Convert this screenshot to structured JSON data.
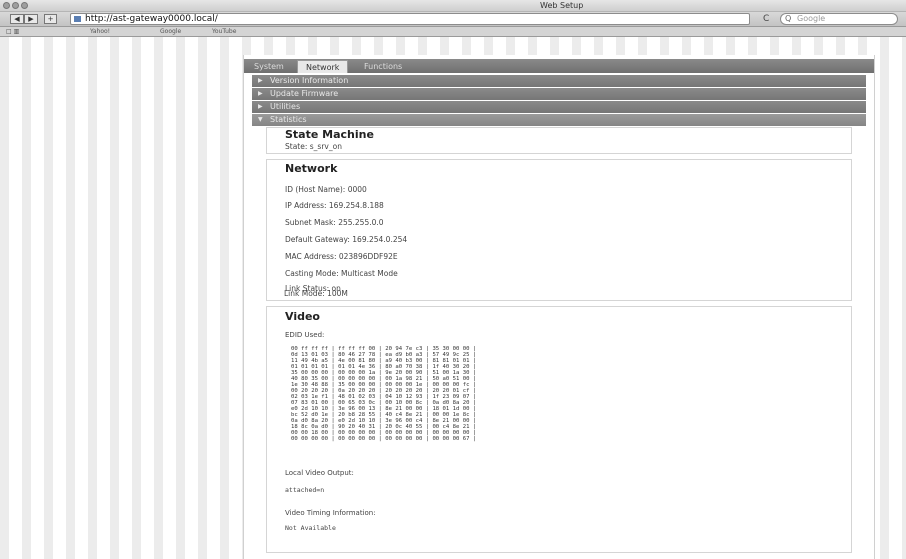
{
  "window": {
    "title": "Web Setup"
  },
  "toolbar": {
    "url": "http://ast-gateway0000.local/",
    "search_placeholder": "Google",
    "back_glyph": "◀",
    "forward_glyph": "▶",
    "add_glyph": "+",
    "reload_glyph": "C"
  },
  "bookmarks": [
    "Yahoo!",
    "Google",
    "YouTube"
  ],
  "tabs": [
    {
      "label": "System"
    },
    {
      "label": "Network"
    },
    {
      "label": "Functions"
    }
  ],
  "sections": [
    {
      "label": "Version Information",
      "expanded": false
    },
    {
      "label": "Update Firmware",
      "expanded": false
    },
    {
      "label": "Utilities",
      "expanded": false
    },
    {
      "label": "Statistics",
      "expanded": true
    }
  ],
  "state_machine": {
    "title": "State Machine",
    "state": "State: s_srv_on"
  },
  "network": {
    "title": "Network",
    "fields": [
      "ID (Host Name): 0000",
      "IP Address: 169.254.8.188",
      "Subnet Mask: 255.255.0.0",
      "Default Gateway: 169.254.0.254",
      "MAC Address: 023896DDF92E",
      "Casting Mode: Multicast Mode",
      "Link Status: on",
      "Link Mode: 100M"
    ]
  },
  "video": {
    "title": "Video",
    "edid_label": "EDID Used:",
    "edid_rows": [
      "00 ff ff ff | ff ff ff 00 | 20 94 7e c3 | 35 30 00 00 |",
      "0d 13 01 03 | 80 46 27 78 | ea d9 b0 a3 | 57 49 9c 25 |",
      "11 49 4b a5 | 4e 00 81 80 | a9 40 b3 00 | 81 81 01 01 |",
      "01 01 01 01 | 01 01 4e 36 | 80 a0 70 38 | 1f 40 30 20 |",
      "35 00 00 00 | 00 00 00 1a | 9e 20 00 90 | 51 00 1a 30 |",
      "40 80 35 00 | 00 00 00 00 | 00 1a 98 21 | 50 a0 51 00 |",
      "1e 30 48 88 | 35 00 00 00 | 00 00 00 1e | 00 00 00 fc |",
      "00 20 20 20 | 0a 20 20 20 | 20 20 20 20 | 20 20 01 cf |",
      "02 03 1e f1 | 48 01 02 03 | 04 10 12 93 | 1f 23 09 07 |",
      "07 83 01 00 | 00 65 03 0c | 00 10 00 8c | 0a d0 8a 20 |",
      "e0 2d 10 10 | 3e 96 00 13 | 8e 21 00 00 | 18 01 1d 00 |",
      "bc 52 d0 1e | 20 b8 28 55 | 40 c4 8e 21 | 00 00 1e 8c |",
      "0a d0 8a 20 | e0 2d 10 10 | 3e 96 00 c4 | 8e 21 00 00 |",
      "18 8c 0a d0 | 90 20 40 31 | 20 0c 40 55 | 00 c4 8e 21 |",
      "00 00 18 00 | 00 00 00 00 | 00 00 00 00 | 00 00 00 00 |",
      "00 00 00 00 | 00 00 00 00 | 00 00 00 00 | 00 00 00 67 |"
    ],
    "local_output_label": "Local Video Output:",
    "local_output_value": "attached=n",
    "timing_label": "Video Timing Information:",
    "timing_value": "Not Available"
  }
}
